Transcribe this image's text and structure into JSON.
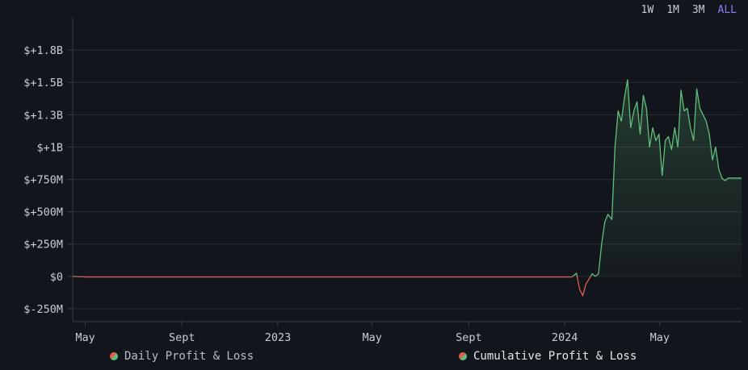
{
  "range_selector": {
    "options": [
      "1W",
      "1M",
      "3M",
      "ALL"
    ],
    "active": "ALL"
  },
  "legend": {
    "daily": "Daily Profit & Loss",
    "cumulative": "Cumulative Profit & Loss"
  },
  "colors": {
    "background": "#13151c",
    "grid": "#2a2d36",
    "positive": "#5fbf7a",
    "negative": "#e35d4f",
    "range_active": "#8b7cf6"
  },
  "chart_data": {
    "type": "area",
    "series": [
      {
        "name": "Cumulative Profit & Loss",
        "x": [
          "2022-04-15",
          "2022-05-01",
          "2022-06-01",
          "2022-07-01",
          "2022-08-01",
          "2022-09-01",
          "2022-10-01",
          "2022-11-01",
          "2022-12-01",
          "2023-01-01",
          "2023-02-01",
          "2023-03-01",
          "2023-04-01",
          "2023-05-01",
          "2023-06-01",
          "2023-07-01",
          "2023-08-01",
          "2023-09-01",
          "2023-10-01",
          "2023-11-01",
          "2023-12-01",
          "2024-01-10",
          "2024-01-16",
          "2024-01-20",
          "2024-01-24",
          "2024-01-28",
          "2024-02-01",
          "2024-02-05",
          "2024-02-09",
          "2024-02-13",
          "2024-02-17",
          "2024-02-21",
          "2024-02-25",
          "2024-03-01",
          "2024-03-05",
          "2024-03-09",
          "2024-03-13",
          "2024-03-17",
          "2024-03-21",
          "2024-03-25",
          "2024-03-29",
          "2024-04-02",
          "2024-04-06",
          "2024-04-10",
          "2024-04-14",
          "2024-04-18",
          "2024-04-22",
          "2024-04-26",
          "2024-04-30",
          "2024-05-04",
          "2024-05-08",
          "2024-05-12",
          "2024-05-16",
          "2024-05-20",
          "2024-05-24",
          "2024-05-28",
          "2024-06-01",
          "2024-06-05",
          "2024-06-09",
          "2024-06-13",
          "2024-06-17",
          "2024-06-21",
          "2024-06-25",
          "2024-06-29",
          "2024-07-03",
          "2024-07-07",
          "2024-07-11",
          "2024-07-15",
          "2024-07-19",
          "2024-07-23",
          "2024-07-27",
          "2024-08-01",
          "2024-08-05",
          "2024-08-09",
          "2024-08-13"
        ],
        "values": [
          0,
          -5000000,
          -5000000,
          -5000000,
          -5000000,
          -5000000,
          -5000000,
          -5000000,
          -5000000,
          -5000000,
          -5000000,
          -5000000,
          -5000000,
          -5000000,
          -5000000,
          -5000000,
          -5000000,
          -5000000,
          -5000000,
          -5000000,
          -5000000,
          -5000000,
          25000000,
          -100000000,
          -150000000,
          -60000000,
          -20000000,
          20000000,
          0,
          20000000,
          250000000,
          420000000,
          480000000,
          440000000,
          1000000000,
          1280000000,
          1200000000,
          1380000000,
          1520000000,
          1150000000,
          1280000000,
          1350000000,
          1100000000,
          1400000000,
          1300000000,
          1000000000,
          1150000000,
          1050000000,
          1100000000,
          780000000,
          1050000000,
          1080000000,
          980000000,
          1150000000,
          1000000000,
          1440000000,
          1280000000,
          1300000000,
          1150000000,
          1050000000,
          1450000000,
          1300000000,
          1250000000,
          1200000000,
          1100000000,
          900000000,
          1000000000,
          830000000,
          760000000,
          740000000,
          760000000,
          760000000,
          760000000,
          760000000,
          760000000
        ]
      }
    ],
    "y_ticks": [
      {
        "value": 1750000000,
        "label": "$+1.8B"
      },
      {
        "value": 1500000000,
        "label": "$+1.5B"
      },
      {
        "value": 1250000000,
        "label": "$+1.3B"
      },
      {
        "value": 1000000000,
        "label": "$+1B"
      },
      {
        "value": 750000000,
        "label": "$+750M"
      },
      {
        "value": 500000000,
        "label": "$+500M"
      },
      {
        "value": 250000000,
        "label": "$+250M"
      },
      {
        "value": 0,
        "label": "$0"
      },
      {
        "value": -250000000,
        "label": "$-250M"
      }
    ],
    "x_ticks": [
      {
        "date": "2022-05-01",
        "label": "May"
      },
      {
        "date": "2022-09-01",
        "label": "Sept"
      },
      {
        "date": "2023-01-01",
        "label": "2023"
      },
      {
        "date": "2023-05-01",
        "label": "May"
      },
      {
        "date": "2023-09-01",
        "label": "Sept"
      },
      {
        "date": "2024-01-01",
        "label": "2024"
      },
      {
        "date": "2024-05-01",
        "label": "May"
      }
    ],
    "xlim": [
      "2022-04-15",
      "2024-08-13"
    ],
    "ylim": [
      -350000000,
      2000000000
    ],
    "grid": true,
    "legend_position": "bottom"
  }
}
